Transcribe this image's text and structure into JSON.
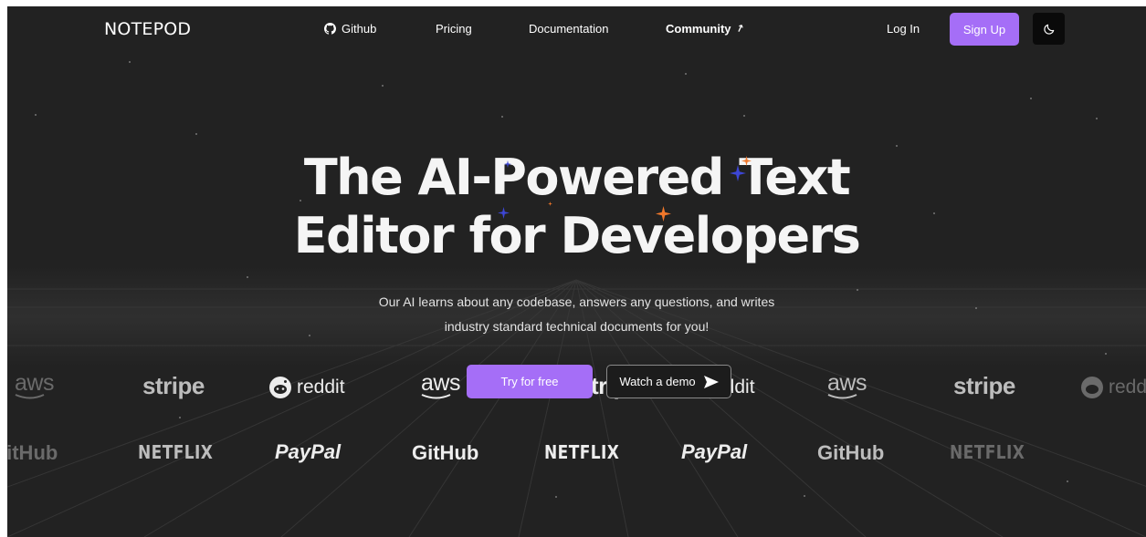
{
  "nav": {
    "logo": "NOTEPOD",
    "links": {
      "github": "Github",
      "pricing": "Pricing",
      "documentation": "Documentation",
      "community": "Community"
    },
    "login": "Log In",
    "signup": "Sign Up"
  },
  "hero": {
    "title_line1": "The AI-Powered Text",
    "title_line2": "Editor for Developers",
    "subtitle_line1": "Our AI learns about any codebase, answers any questions, and writes",
    "subtitle_line2": "industry standard technical documents for you!",
    "cta_primary": "Try for free",
    "cta_secondary": "Watch a demo"
  },
  "logos": {
    "row1": [
      "aws",
      "stripe",
      "reddit",
      "aws",
      "stripe",
      "reddit",
      "aws",
      "stripe",
      "reddit"
    ],
    "row2": [
      "GitHub",
      "NETFLIX",
      "PayPal",
      "GitHub",
      "NETFLIX",
      "PayPal",
      "GitHub",
      "NETFLIX"
    ]
  },
  "colors": {
    "background": "#222222",
    "accent": "#a56ef7",
    "sparkle_blue": "#3d46d6",
    "sparkle_orange": "#f0772a"
  },
  "icons": {
    "github": "github-icon",
    "community_arrow": "arrow-up-right-icon",
    "theme_toggle": "moon-icon",
    "play": "play-icon"
  }
}
